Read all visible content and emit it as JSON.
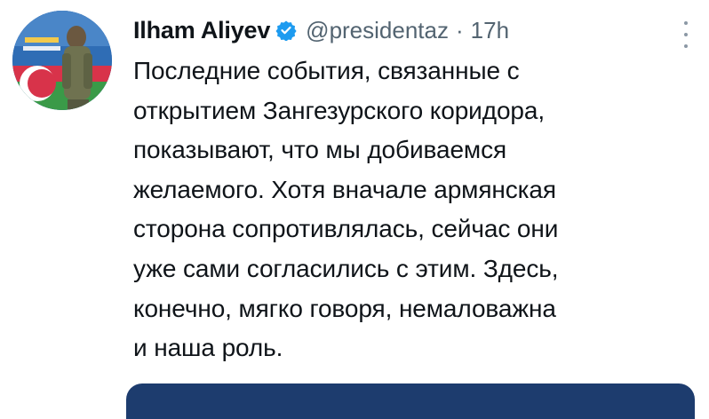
{
  "tweet": {
    "author_name": "Ilham Aliyev",
    "handle": "@presidentaz",
    "separator": "·",
    "time": "17h",
    "verified": true,
    "text_lines": [
      "Последние события, связанные с",
      "открытием Зангезурского коридора,",
      "показывают, что мы добиваемся",
      "желаемого. Хотя вначале армянская",
      "сторона сопротивлялась, сейчас они",
      "уже сами согласились с этим. Здесь,",
      "конечно, мягко говоря, немаловажна",
      "и наша роль."
    ]
  },
  "icons": {
    "verified": "verified-badge-icon",
    "more": "more-options-icon"
  },
  "colors": {
    "text": "#0f1419",
    "secondary": "#536471",
    "verified": "#1d9bf0",
    "card": "#1d3c6e"
  }
}
